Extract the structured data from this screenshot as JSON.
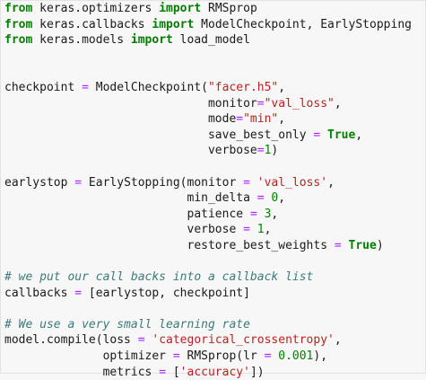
{
  "editor": {
    "lines": [
      [
        {
          "t": "kw",
          "v": "from"
        },
        {
          "t": "txt",
          "v": " keras.optimizers "
        },
        {
          "t": "kw",
          "v": "import"
        },
        {
          "t": "txt",
          "v": " RMSprop"
        }
      ],
      [
        {
          "t": "kw",
          "v": "from"
        },
        {
          "t": "txt",
          "v": " keras.callbacks "
        },
        {
          "t": "kw",
          "v": "import"
        },
        {
          "t": "txt",
          "v": " ModelCheckpoint, EarlyStopping"
        }
      ],
      [
        {
          "t": "kw",
          "v": "from"
        },
        {
          "t": "txt",
          "v": " keras.models "
        },
        {
          "t": "kw",
          "v": "import"
        },
        {
          "t": "txt",
          "v": " load_model"
        }
      ],
      [],
      [],
      [
        {
          "t": "txt",
          "v": "checkpoint "
        },
        {
          "t": "op",
          "v": "="
        },
        {
          "t": "txt",
          "v": " ModelCheckpoint("
        },
        {
          "t": "str",
          "v": "\"facer.h5\""
        },
        {
          "t": "txt",
          "v": ","
        }
      ],
      [
        {
          "t": "txt",
          "v": "                             monitor"
        },
        {
          "t": "op",
          "v": "="
        },
        {
          "t": "str",
          "v": "\"val_loss\""
        },
        {
          "t": "txt",
          "v": ","
        }
      ],
      [
        {
          "t": "txt",
          "v": "                             mode"
        },
        {
          "t": "op",
          "v": "="
        },
        {
          "t": "str",
          "v": "\"min\""
        },
        {
          "t": "txt",
          "v": ","
        }
      ],
      [
        {
          "t": "txt",
          "v": "                             save_best_only "
        },
        {
          "t": "op",
          "v": "="
        },
        {
          "t": "txt",
          "v": " "
        },
        {
          "t": "const",
          "v": "True"
        },
        {
          "t": "txt",
          "v": ","
        }
      ],
      [
        {
          "t": "txt",
          "v": "                             verbose"
        },
        {
          "t": "op",
          "v": "="
        },
        {
          "t": "num",
          "v": "1"
        },
        {
          "t": "txt",
          "v": ")"
        }
      ],
      [],
      [
        {
          "t": "txt",
          "v": "earlystop "
        },
        {
          "t": "op",
          "v": "="
        },
        {
          "t": "txt",
          "v": " EarlyStopping(monitor "
        },
        {
          "t": "op",
          "v": "="
        },
        {
          "t": "txt",
          "v": " "
        },
        {
          "t": "str",
          "v": "'val_loss'"
        },
        {
          "t": "txt",
          "v": ","
        }
      ],
      [
        {
          "t": "txt",
          "v": "                          min_delta "
        },
        {
          "t": "op",
          "v": "="
        },
        {
          "t": "txt",
          "v": " "
        },
        {
          "t": "num",
          "v": "0"
        },
        {
          "t": "txt",
          "v": ","
        }
      ],
      [
        {
          "t": "txt",
          "v": "                          patience "
        },
        {
          "t": "op",
          "v": "="
        },
        {
          "t": "txt",
          "v": " "
        },
        {
          "t": "num",
          "v": "3"
        },
        {
          "t": "txt",
          "v": ","
        }
      ],
      [
        {
          "t": "txt",
          "v": "                          verbose "
        },
        {
          "t": "op",
          "v": "="
        },
        {
          "t": "txt",
          "v": " "
        },
        {
          "t": "num",
          "v": "1"
        },
        {
          "t": "txt",
          "v": ","
        }
      ],
      [
        {
          "t": "txt",
          "v": "                          restore_best_weights "
        },
        {
          "t": "op",
          "v": "="
        },
        {
          "t": "txt",
          "v": " "
        },
        {
          "t": "const",
          "v": "True"
        },
        {
          "t": "txt",
          "v": ")"
        }
      ],
      [],
      [
        {
          "t": "cmt",
          "v": "# we put our call backs into a callback list"
        }
      ],
      [
        {
          "t": "txt",
          "v": "callbacks "
        },
        {
          "t": "op",
          "v": "="
        },
        {
          "t": "txt",
          "v": " [earlystop, checkpoint]"
        }
      ],
      [],
      [
        {
          "t": "cmt",
          "v": "# We use a very small learning rate"
        }
      ],
      [
        {
          "t": "txt",
          "v": "model.compile(loss "
        },
        {
          "t": "op",
          "v": "="
        },
        {
          "t": "txt",
          "v": " "
        },
        {
          "t": "str",
          "v": "'categorical_crossentropy'"
        },
        {
          "t": "txt",
          "v": ","
        }
      ],
      [
        {
          "t": "txt",
          "v": "              optimizer "
        },
        {
          "t": "op",
          "v": "="
        },
        {
          "t": "txt",
          "v": " RMSprop(lr "
        },
        {
          "t": "op",
          "v": "="
        },
        {
          "t": "txt",
          "v": " "
        },
        {
          "t": "num",
          "v": "0.001"
        },
        {
          "t": "txt",
          "v": "),"
        }
      ],
      [
        {
          "t": "txt",
          "v": "              metrics "
        },
        {
          "t": "op",
          "v": "="
        },
        {
          "t": "txt",
          "v": " ["
        },
        {
          "t": "str",
          "v": "'accuracy'"
        },
        {
          "t": "txt",
          "v": "])"
        }
      ]
    ]
  }
}
